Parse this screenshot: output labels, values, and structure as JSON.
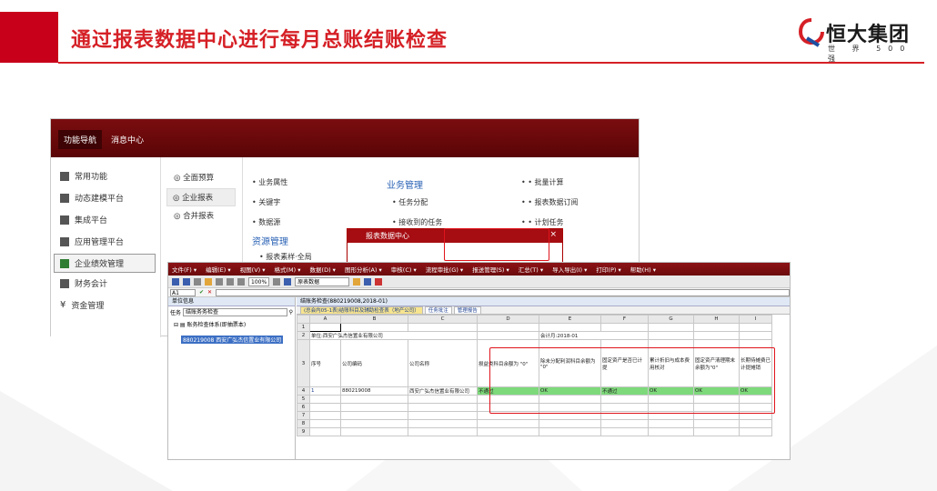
{
  "header": {
    "title": "通过报表数据中心进行每月总账结账检查",
    "logo_text": "恒大集团",
    "logo_sub": "世 界 500 强",
    "accent_color": "#d52026"
  },
  "back_window": {
    "tabs": [
      "功能导航",
      "消息中心"
    ],
    "nav": [
      "常用功能",
      "动态建模平台",
      "集成平台",
      "应用管理平台",
      "企业绩效管理",
      "财务会计",
      "资金管理"
    ],
    "col2": [
      "全面预算",
      "企业报表",
      "合并报表"
    ],
    "col3_a": [
      "业务属性",
      "关键字",
      "数据源"
    ],
    "col3_a_head": "资源管理",
    "col3_a_more": "• 报表素样·全局",
    "col3_b_head": "业务管理",
    "col3_b": [
      "• 任务分配",
      "• 接收到的任务"
    ],
    "col3_c": [
      "• 批量计算",
      "• 报表数据订阅",
      "• 计划任务"
    ],
    "dialog_title": "报表数据中心",
    "dialog_close": "×"
  },
  "front_window": {
    "menus": [
      "文件(F) ▾",
      "编辑(E) ▾",
      "视图(V) ▾",
      "格式(M) ▾",
      "数据(D) ▾",
      "图形分析(A) ▾",
      "审核(C) ▾",
      "流程审批(G) ▾",
      "报送管理(S) ▾",
      "汇总(T) ▾",
      "导入导出(I) ▾",
      "打印(P) ▾",
      "帮助(H) ▾"
    ],
    "zoom": "100%",
    "report_type": "原表数据",
    "cell_ref": "A1",
    "left_header": "单位信息",
    "search_label": "任务",
    "search_value": "结账务务检查",
    "tree_root": "账务检查体系(即抽票本)",
    "tree_child": "880219008 西安广弘杰信置业有限公司",
    "right_header": "结账务检查(880219008,2018-01)",
    "tabs": [
      "(总会内05-1表)结账科目及辅助检查表（地产公司）",
      "任务批注",
      "管理报告"
    ],
    "col_headers": [
      "A",
      "B",
      "C",
      "D",
      "E",
      "F",
      "G",
      "H",
      "I"
    ],
    "row2_unit": "单位:西安广弘杰信置业有限公司",
    "row2_period": "会计月:2018-01",
    "row3": [
      "序号",
      "公司编码",
      "公司名称",
      "损益类科目余额为 \"0\"",
      "除未分配利润科目余额为 \"0\"",
      "固定资产是否已计提",
      "累计折旧与成本费用核对",
      "固定资产清理期末余额为\"0\"",
      "长期待摊费已计提摊销"
    ],
    "row4": [
      "1",
      "880219008",
      "西安广弘杰信置业有限公司",
      "不通过",
      "OK",
      "不通过",
      "OK",
      "OK",
      "OK"
    ],
    "row_numbers": [
      "1",
      "2",
      "3",
      "4",
      "5",
      "6",
      "7",
      "8",
      "9"
    ]
  }
}
